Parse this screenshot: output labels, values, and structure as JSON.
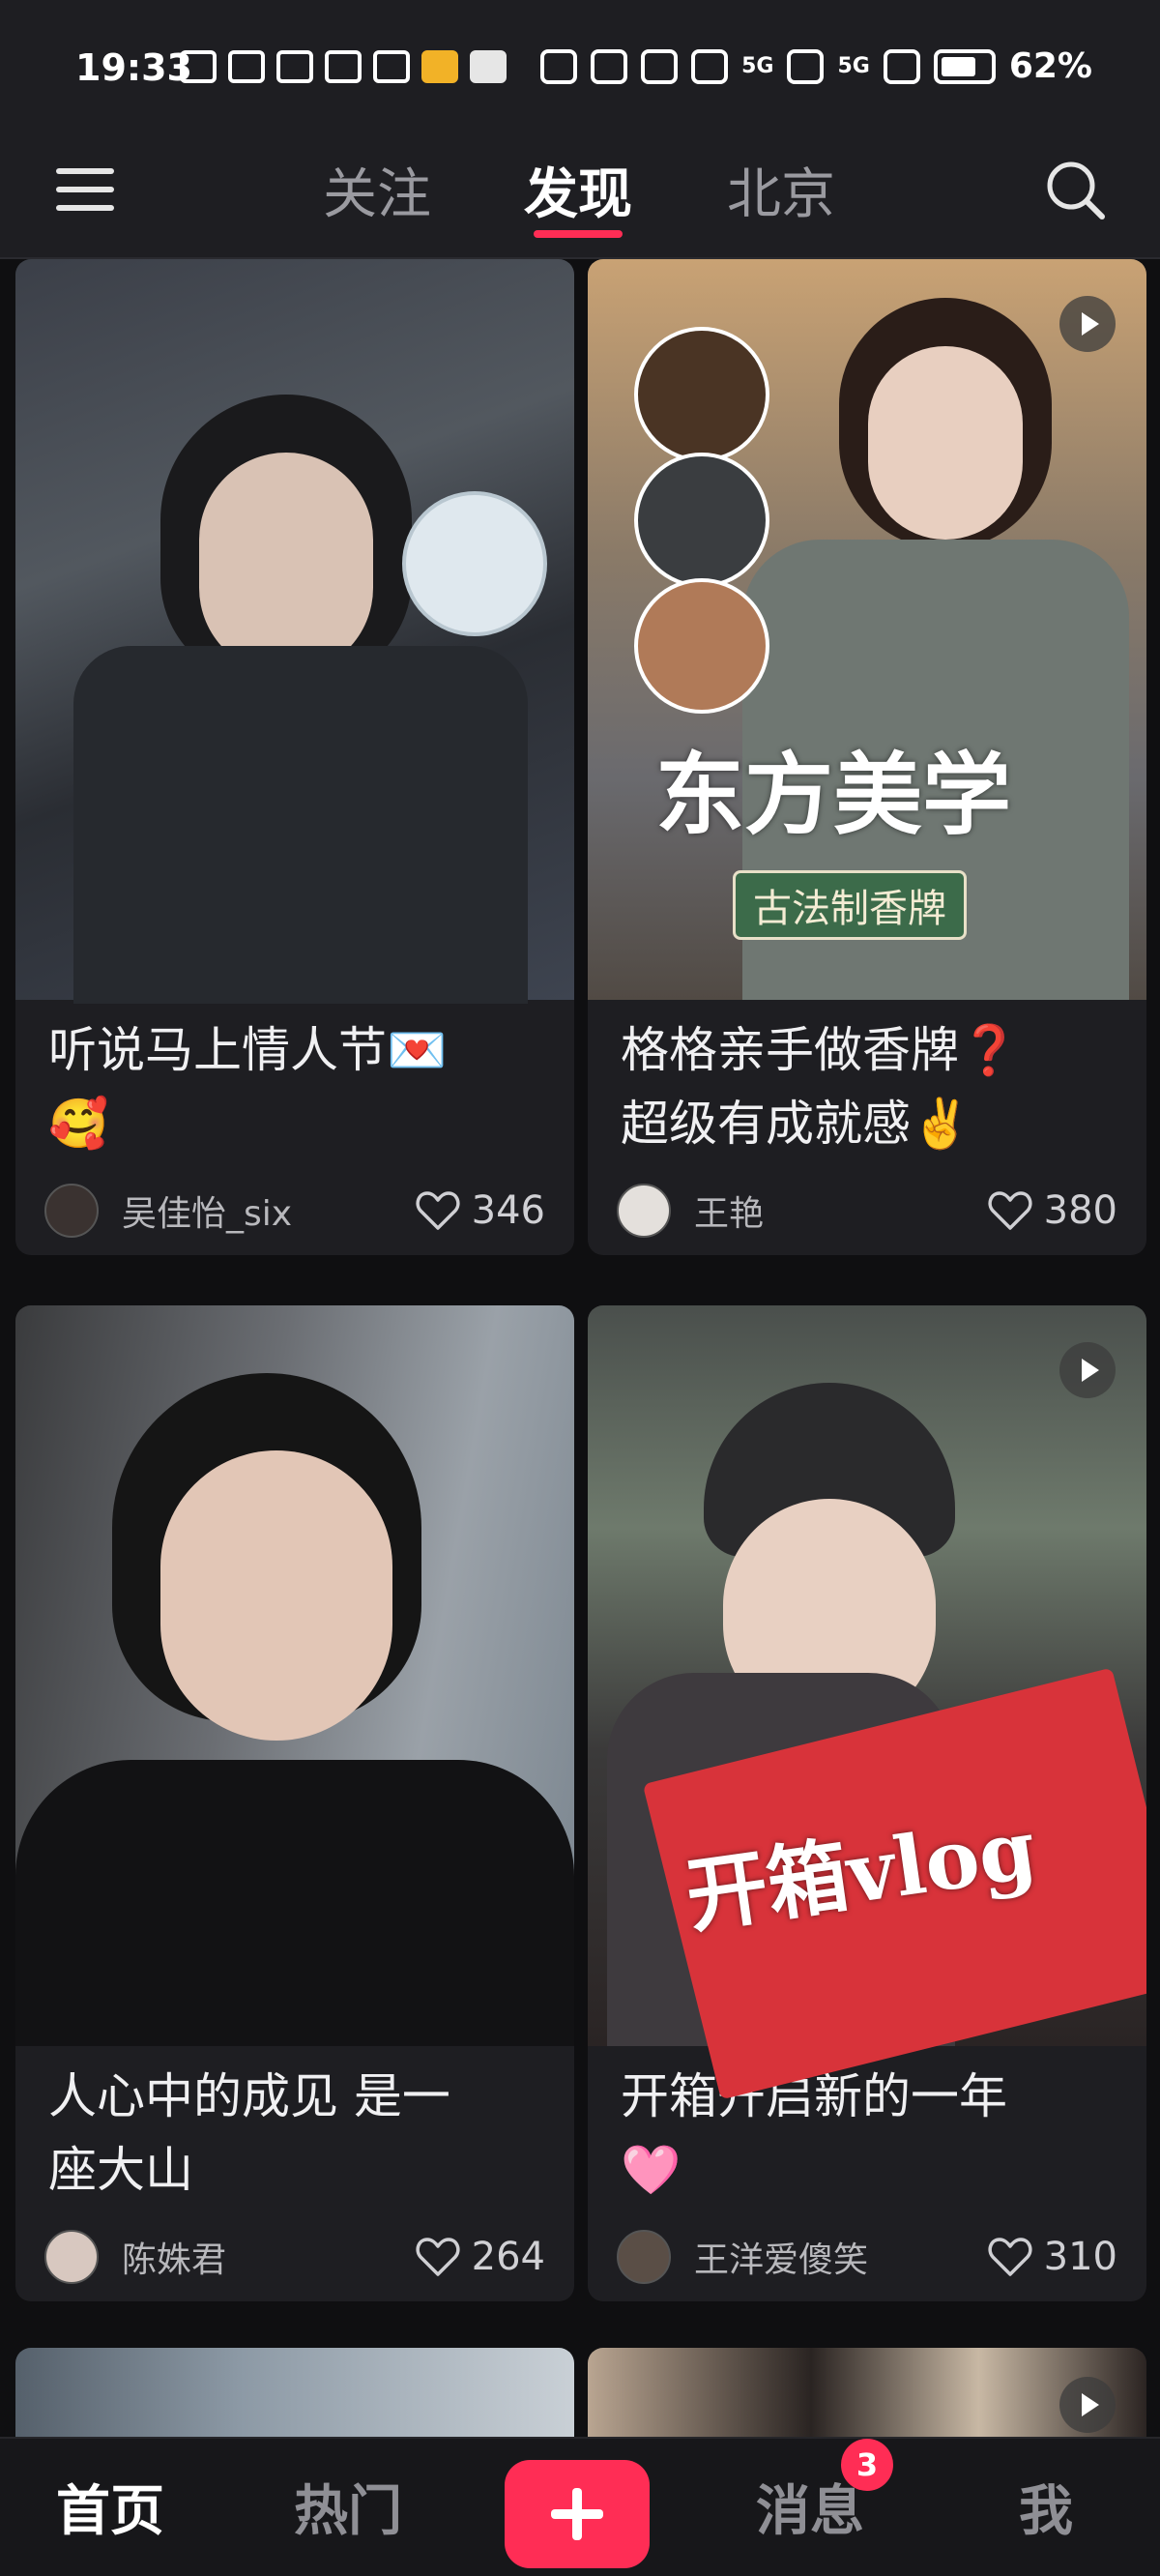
{
  "status_bar": {
    "time": "19:33",
    "signal_1": "5G",
    "signal_2": "5G",
    "battery": "62%"
  },
  "top_nav": {
    "tabs": [
      {
        "label": "关注",
        "active": false
      },
      {
        "label": "发现",
        "active": true
      },
      {
        "label": "北京",
        "active": false
      }
    ],
    "accent_color": "#ff2d55"
  },
  "feed": {
    "cards": [
      {
        "title": "听说马上情人节💌",
        "title_line2": "🥰",
        "author": "吴佳怡_six",
        "likes": "346",
        "is_video": false
      },
      {
        "title": "格格亲手做香牌❓",
        "title_line2": "超级有成就感✌️",
        "author": "王艳",
        "likes": "380",
        "is_video": true,
        "overlay_text": "东方美学",
        "overlay_sub": "古法制香牌"
      },
      {
        "title": "人心中的成见 是一",
        "title_line2": "座大山",
        "author": "陈姝君",
        "likes": "264",
        "is_video": false
      },
      {
        "title": "开箱开启新的一年",
        "title_line2": "🩷",
        "author": "王洋爱傻笑",
        "likes": "310",
        "is_video": true,
        "overlay_text": "开箱vlog"
      }
    ]
  },
  "bottom_nav": {
    "home": "首页",
    "hot": "热门",
    "messages": "消息",
    "messages_badge": "3",
    "me": "我"
  }
}
